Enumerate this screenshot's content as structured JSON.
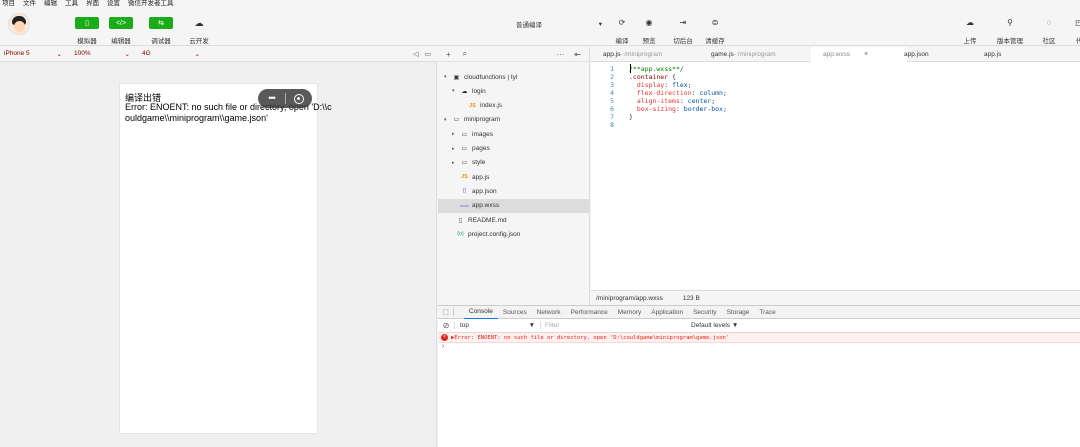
{
  "menu": [
    "项目",
    "文件",
    "编辑",
    "工具",
    "界面",
    "设置",
    "微信开发者工具"
  ],
  "toolbar": {
    "modes": [
      {
        "label": "模拟器",
        "icon": "phone-icon",
        "glyph": "▯"
      },
      {
        "label": "编辑器",
        "icon": "code-icon",
        "glyph": "</>"
      },
      {
        "label": "调试器",
        "icon": "debug-icon",
        "glyph": "⇆"
      },
      {
        "label": "云开发",
        "icon": "cloud-icon",
        "glyph": "☁"
      }
    ],
    "compile_mode": "普通编译",
    "actions": [
      {
        "label": "编译",
        "glyph": "⟳"
      },
      {
        "label": "预览",
        "glyph": "◉"
      },
      {
        "label": "切后台",
        "glyph": "⇥"
      },
      {
        "label": "清缓存",
        "glyph": "⊜"
      }
    ],
    "right_actions": [
      {
        "label": "上传",
        "glyph": "☁"
      },
      {
        "label": "版本管理",
        "glyph": "⚲"
      },
      {
        "label": "社区",
        "glyph": "◌"
      },
      {
        "label": "代",
        "glyph": "◰"
      }
    ]
  },
  "device": {
    "model": "iPhone 5",
    "zoom": "100%",
    "network": "4G"
  },
  "simulator": {
    "error_title": "编译出错",
    "error_message": "Error: ENOENT: no such file or directory, open 'D:\\\\couldgame\\\\miniprogram\\\\game.json'"
  },
  "filetree": {
    "items": [
      {
        "label": "cloudfunctions | tyl",
        "arrow": "▾",
        "icon": "▣",
        "type": "folder"
      },
      {
        "label": "login",
        "arrow": "▾",
        "icon": "☁",
        "type": "folder"
      },
      {
        "label": "index.js",
        "arrow": "",
        "icon": "JS",
        "type": "js"
      },
      {
        "label": "miniprogram",
        "arrow": "▾",
        "icon": "▭",
        "type": "folder"
      },
      {
        "label": "images",
        "arrow": "▸",
        "icon": "▭",
        "type": "folder"
      },
      {
        "label": "pages",
        "arrow": "▸",
        "icon": "▭",
        "type": "folder"
      },
      {
        "label": "style",
        "arrow": "▸",
        "icon": "▭",
        "type": "folder"
      },
      {
        "label": "app.js",
        "arrow": "",
        "icon": "JS",
        "type": "js"
      },
      {
        "label": "app.json",
        "arrow": "",
        "icon": "{}",
        "type": "json"
      },
      {
        "label": "app.wxss",
        "arrow": "",
        "icon": "wxss",
        "type": "wxss",
        "active": true
      },
      {
        "label": "README.md",
        "arrow": "",
        "icon": "▯",
        "type": "md"
      },
      {
        "label": "project.config.json",
        "arrow": "",
        "icon": "{o}",
        "type": "cfg"
      }
    ]
  },
  "tabs": [
    {
      "name": "app.js",
      "path": " - /miniprogram"
    },
    {
      "name": "game.js",
      "path": " - /miniprogram"
    },
    {
      "name": "app.wxss",
      "path": "",
      "active": true
    },
    {
      "name": "app.json",
      "path": ""
    },
    {
      "name": "app.js",
      "path": ""
    }
  ],
  "code_lines": [
    [
      {
        "t": "/**app.wxss**/",
        "c": "cm"
      }
    ],
    [
      {
        "t": ".container",
        "c": "sel"
      },
      {
        "t": " {",
        "c": "pn"
      }
    ],
    [
      {
        "t": "  display",
        "c": "prop"
      },
      {
        "t": ": ",
        "c": "pn"
      },
      {
        "t": "flex",
        "c": "val"
      },
      {
        "t": ";",
        "c": "pn"
      }
    ],
    [
      {
        "t": "  flex-direction",
        "c": "prop"
      },
      {
        "t": ": ",
        "c": "pn"
      },
      {
        "t": "column",
        "c": "val"
      },
      {
        "t": ";",
        "c": "pn"
      }
    ],
    [
      {
        "t": "  align-items",
        "c": "prop"
      },
      {
        "t": ": ",
        "c": "pn"
      },
      {
        "t": "center",
        "c": "val"
      },
      {
        "t": ";",
        "c": "pn"
      }
    ],
    [
      {
        "t": "  box-sizing",
        "c": "prop"
      },
      {
        "t": ": ",
        "c": "pn"
      },
      {
        "t": "border-box",
        "c": "val"
      },
      {
        "t": ";",
        "c": "pn"
      }
    ],
    [
      {
        "t": "}",
        "c": "pn"
      }
    ],
    []
  ],
  "status": {
    "path": "/miniprogram/app.wxss",
    "size": "123 B"
  },
  "devtools": {
    "tabs": [
      "Console",
      "Sources",
      "Network",
      "Performance",
      "Memory",
      "Application",
      "Security",
      "Storage",
      "Trace"
    ],
    "context": "top",
    "filter_placeholder": "Filter",
    "levels": "Default levels ▼",
    "error": "▶Error: ENOENT: no such file or directory, open 'D:\\couldgame\\miniprogram\\game.json'"
  }
}
